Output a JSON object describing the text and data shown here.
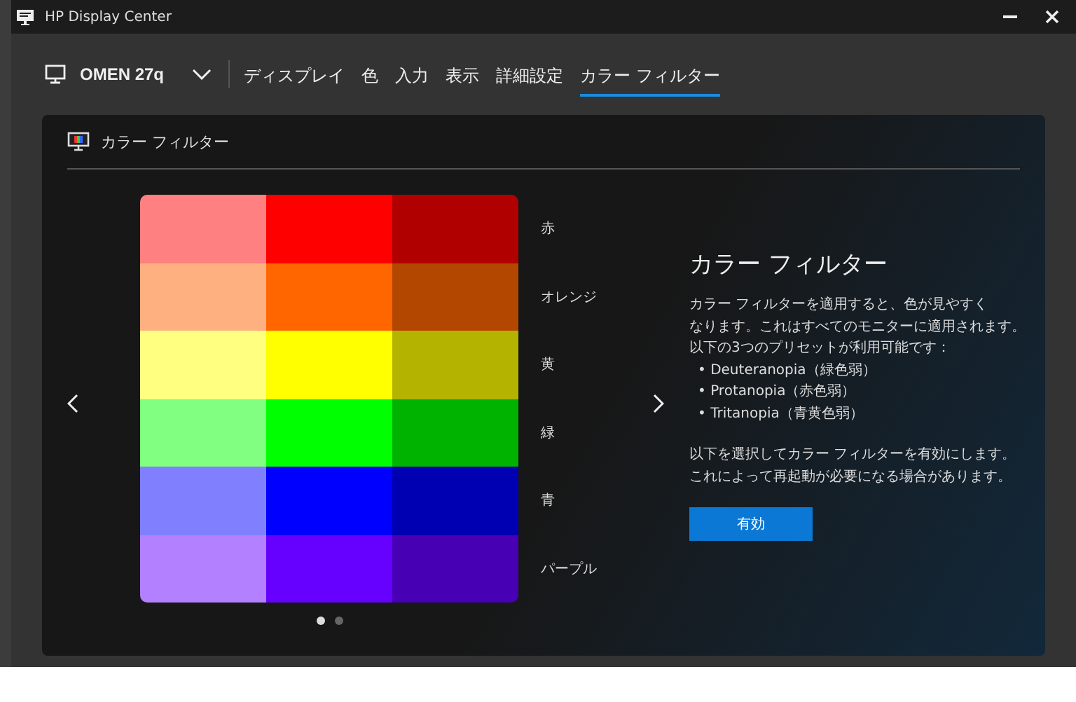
{
  "window": {
    "title": "HP Display Center"
  },
  "device": {
    "name": "OMEN 27q"
  },
  "tabs": [
    {
      "label": "ディスプレイ",
      "selected": false
    },
    {
      "label": "色",
      "selected": false
    },
    {
      "label": "入力",
      "selected": false
    },
    {
      "label": "表示",
      "selected": false
    },
    {
      "label": "詳細設定",
      "selected": false
    },
    {
      "label": "カラー フィルター",
      "selected": true
    }
  ],
  "panel": {
    "title": "カラー フィルター",
    "swatch_rows": [
      {
        "label": "赤",
        "swatches": [
          {
            "color": "#ff8080"
          },
          {
            "color": "#ff0000"
          },
          {
            "color": "#b00000"
          }
        ]
      },
      {
        "label": "オレンジ",
        "swatches": [
          {
            "color": "#ffb080"
          },
          {
            "color": "#ff6600"
          },
          {
            "color": "#b34700"
          }
        ]
      },
      {
        "label": "黄",
        "swatches": [
          {
            "color": "#ffff80"
          },
          {
            "color": "#ffff00"
          },
          {
            "color": "#b3b300"
          }
        ]
      },
      {
        "label": "緑",
        "swatches": [
          {
            "color": "#80ff80"
          },
          {
            "color": "#00ff00"
          },
          {
            "color": "#00b300"
          }
        ]
      },
      {
        "label": "青",
        "swatches": [
          {
            "color": "#8080ff"
          },
          {
            "color": "#0000ff"
          },
          {
            "color": "#0000b3"
          }
        ]
      },
      {
        "label": "パープル",
        "swatches": [
          {
            "color": "#b380ff"
          },
          {
            "color": "#6600ff"
          },
          {
            "color": "#4700b3"
          }
        ]
      }
    ],
    "pages": [
      {
        "selected": true
      },
      {
        "selected": false
      }
    ],
    "info": {
      "heading": "カラー フィルター",
      "intro": [
        "カラー フィルターを適用すると、色が見やすく",
        "なります。これはすべてのモニターに適用されます。",
        "以下の3つのプリセットが利用可能です："
      ],
      "presets": [
        "• Deuteranopia（緑色弱）",
        "• Protanopia（赤色弱）",
        "• Tritanopia（青黄色弱）"
      ],
      "note": [
        "以下を選択してカラー フィルターを有効にします。",
        "これによって再起動が必要になる場合があります。"
      ],
      "button": "有効"
    }
  }
}
